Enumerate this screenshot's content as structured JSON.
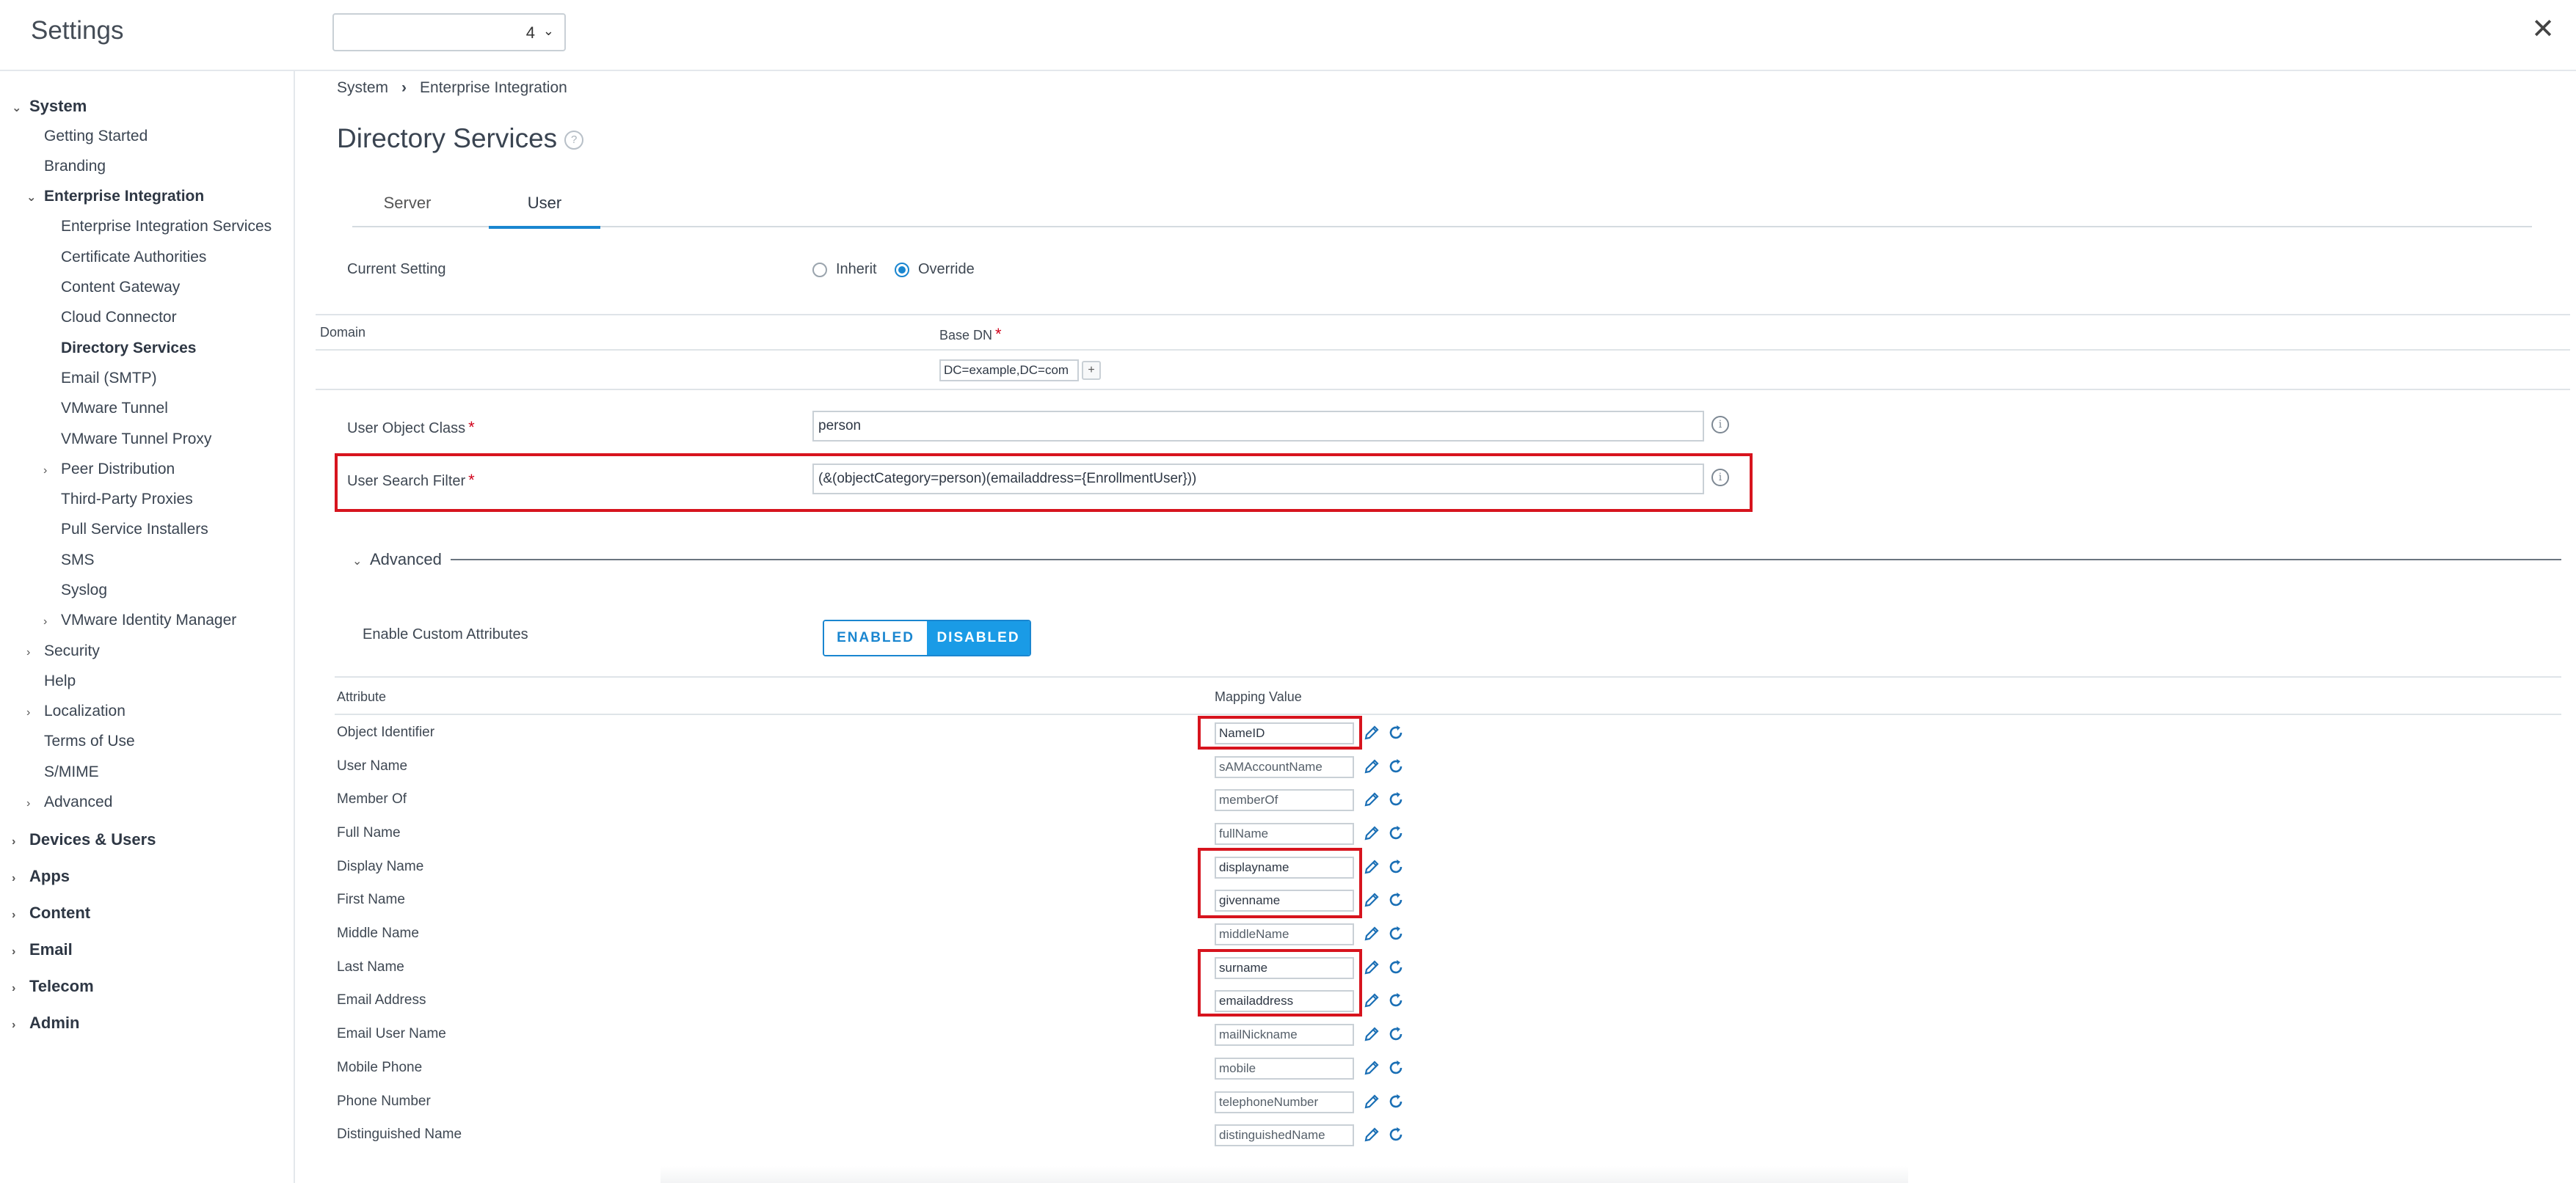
{
  "header": {
    "app_title": "Settings",
    "org_select_value": "4",
    "close_icon": "close-icon"
  },
  "sidebar": {
    "items": [
      {
        "label": "System",
        "level": 0,
        "caret": "expanded"
      },
      {
        "label": "Getting Started",
        "level": 1
      },
      {
        "label": "Branding",
        "level": 1
      },
      {
        "label": "Enterprise Integration",
        "level": 1,
        "caret": "expanded"
      },
      {
        "label": "Enterprise Integration Services",
        "level": 2
      },
      {
        "label": "Certificate Authorities",
        "level": 2
      },
      {
        "label": "Content Gateway",
        "level": 2
      },
      {
        "label": "Cloud Connector",
        "level": 2
      },
      {
        "label": "Directory Services",
        "level": 2,
        "active": true
      },
      {
        "label": "Email (SMTP)",
        "level": 2
      },
      {
        "label": "VMware Tunnel",
        "level": 2
      },
      {
        "label": "VMware Tunnel Proxy",
        "level": 2
      },
      {
        "label": "Peer Distribution",
        "level": 2,
        "caret": "collapsed"
      },
      {
        "label": "Third-Party Proxies",
        "level": 2
      },
      {
        "label": "Pull Service Installers",
        "level": 2
      },
      {
        "label": "SMS",
        "level": 2
      },
      {
        "label": "Syslog",
        "level": 2
      },
      {
        "label": "VMware Identity Manager",
        "level": 2,
        "caret": "collapsed"
      },
      {
        "label": "Security",
        "level": 1,
        "caret": "collapsed"
      },
      {
        "label": "Help",
        "level": 1
      },
      {
        "label": "Localization",
        "level": 1,
        "caret": "collapsed"
      },
      {
        "label": "Terms of Use",
        "level": 1
      },
      {
        "label": "S/MIME",
        "level": 1
      },
      {
        "label": "Advanced",
        "level": 1,
        "caret": "collapsed"
      },
      {
        "label": "Devices & Users",
        "level": 0,
        "caret": "collapsed"
      },
      {
        "label": "Apps",
        "level": 0,
        "caret": "collapsed"
      },
      {
        "label": "Content",
        "level": 0,
        "caret": "collapsed"
      },
      {
        "label": "Email",
        "level": 0,
        "caret": "collapsed"
      },
      {
        "label": "Telecom",
        "level": 0,
        "caret": "collapsed"
      },
      {
        "label": "Admin",
        "level": 0,
        "caret": "collapsed"
      }
    ]
  },
  "breadcrumb": {
    "items": [
      "System",
      "Enterprise Integration"
    ],
    "separator": "›"
  },
  "page": {
    "title": "Directory Services"
  },
  "tabs": [
    {
      "label": "Server",
      "active": false
    },
    {
      "label": "User",
      "active": true
    }
  ],
  "current_setting": {
    "label": "Current Setting",
    "options": [
      {
        "label": "Inherit",
        "checked": false
      },
      {
        "label": "Override",
        "checked": true
      }
    ]
  },
  "domain_table": {
    "domain_header": "Domain",
    "base_dn_header": "Base DN",
    "base_dn_value": "DC=example,DC=com",
    "add_label": "+"
  },
  "fields": {
    "user_object_class": {
      "label": "User Object Class",
      "value": "person"
    },
    "user_search_filter": {
      "label": "User Search Filter",
      "value": "(&(objectCategory=person)(emailaddress={EnrollmentUser}))"
    }
  },
  "advanced": {
    "label": "Advanced",
    "custom_attrs_label": "Enable Custom Attributes",
    "enabled_label": "ENABLED",
    "disabled_label": "DISABLED",
    "selected": "DISABLED"
  },
  "attributes": {
    "headers": {
      "attribute": "Attribute",
      "mapping_value": "Mapping Value"
    },
    "rows": [
      {
        "attribute": "Object Identifier",
        "value": "NameID",
        "edited": true
      },
      {
        "attribute": "User Name",
        "value": "sAMAccountName",
        "edited": false
      },
      {
        "attribute": "Member Of",
        "value": "memberOf",
        "edited": false
      },
      {
        "attribute": "Full Name",
        "value": "fullName",
        "edited": false
      },
      {
        "attribute": "Display Name",
        "value": "displayname",
        "edited": true
      },
      {
        "attribute": "First Name",
        "value": "givenname",
        "edited": true
      },
      {
        "attribute": "Middle Name",
        "value": "middleName",
        "edited": false
      },
      {
        "attribute": "Last Name",
        "value": "surname",
        "edited": true
      },
      {
        "attribute": "Email Address",
        "value": "emailaddress",
        "edited": true
      },
      {
        "attribute": "Email User Name",
        "value": "mailNickname",
        "edited": false
      },
      {
        "attribute": "Mobile Phone",
        "value": "mobile",
        "edited": false
      },
      {
        "attribute": "Phone Number",
        "value": "telephoneNumber",
        "edited": false
      },
      {
        "attribute": "Distinguished Name",
        "value": "distinguishedName",
        "edited": false
      }
    ]
  },
  "colors": {
    "accent": "#1a86d0",
    "highlight_red": "#d7141e",
    "required_star": "#d0021b"
  },
  "icons": {
    "edit": "pencil-icon",
    "reset": "reset-icon",
    "info": "info-icon",
    "help": "help-icon"
  }
}
